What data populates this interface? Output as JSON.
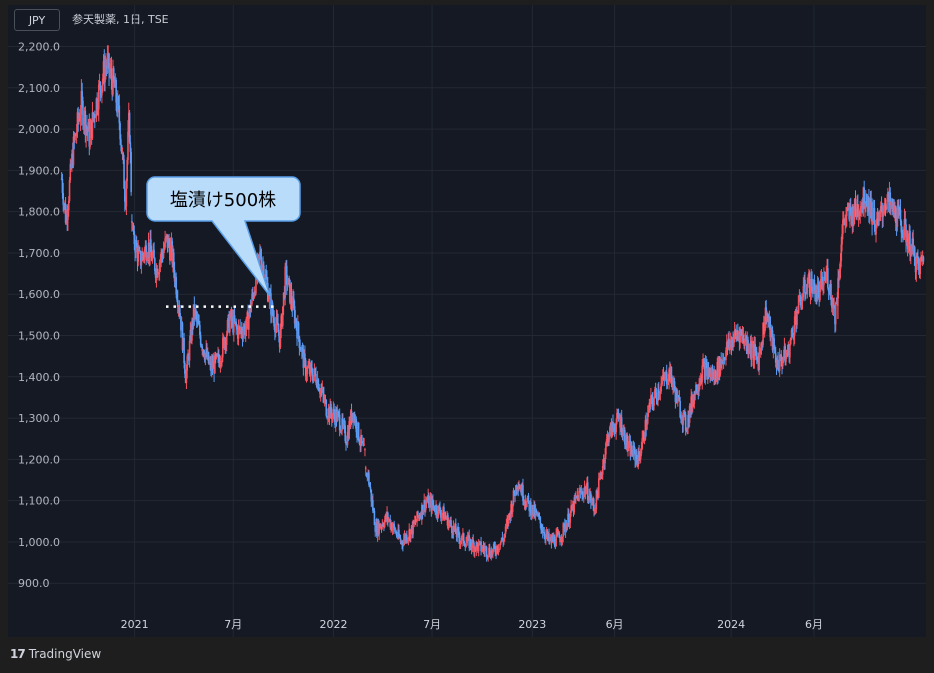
{
  "header": {
    "currency": "JPY",
    "symbol": "参天製薬, 1日, TSE"
  },
  "footer": {
    "brand": "TradingView",
    "logo_icon": "tradingview-logo-icon"
  },
  "annotation": {
    "text": "塩漬け500株",
    "fill": "#b9dcfb",
    "stroke": "#5b9fea",
    "level": 1570
  },
  "colors": {
    "up": "#f7525f",
    "down": "#5b9cf6",
    "background": "#141923",
    "grid": "#232833",
    "axis_text": "#b2b5be"
  },
  "chart_data": {
    "type": "candlestick",
    "title": "参天製薬, 1日, TSE",
    "ylim": [
      840,
      2240
    ],
    "y_ticks": [
      2200,
      2100,
      2000,
      1900,
      1800,
      1700,
      1600,
      1500,
      1400,
      1300,
      1200,
      1100,
      1000,
      900
    ],
    "y_tick_labels": [
      "2,200.0",
      "2,100.0",
      "2,000.0",
      "1,900.0",
      "1,800.0",
      "1,700.0",
      "1,600.0",
      "1,500.0",
      "1,400.0",
      "1,300.0",
      "1,200.0",
      "1,100.0",
      "1,000.0",
      "900.0"
    ],
    "x_range": [
      "2020-08-17",
      "2024-12-20"
    ],
    "x_ticks": [
      {
        "date": "2021-01-01",
        "label": "2021"
      },
      {
        "date": "2021-07-01",
        "label": "7月"
      },
      {
        "date": "2022-01-01",
        "label": "2022"
      },
      {
        "date": "2022-07-01",
        "label": "7月"
      },
      {
        "date": "2023-01-01",
        "label": "2023"
      },
      {
        "date": "2023-06-01",
        "label": "6月"
      },
      {
        "date": "2024-01-01",
        "label": "2024"
      },
      {
        "date": "2024-06-01",
        "label": "6月"
      }
    ],
    "price_path": [
      [
        "2020-08-20",
        1880
      ],
      [
        "2020-08-28",
        1780
      ],
      [
        "2020-09-10",
        1950
      ],
      [
        "2020-09-25",
        2060
      ],
      [
        "2020-10-10",
        1980
      ],
      [
        "2020-10-25",
        2080
      ],
      [
        "2020-11-10",
        2160
      ],
      [
        "2020-11-25",
        2100
      ],
      [
        "2020-12-05",
        2010
      ],
      [
        "2020-12-15",
        1830
      ],
      [
        "2020-12-22",
        2030
      ],
      [
        "2020-12-28",
        1750
      ],
      [
        "2021-01-10",
        1680
      ],
      [
        "2021-01-25",
        1720
      ],
      [
        "2021-02-10",
        1660
      ],
      [
        "2021-03-01",
        1730
      ],
      [
        "2021-03-10",
        1700
      ],
      [
        "2021-03-25",
        1560
      ],
      [
        "2021-04-05",
        1400
      ],
      [
        "2021-04-20",
        1560
      ],
      [
        "2021-05-05",
        1480
      ],
      [
        "2021-05-20",
        1420
      ],
      [
        "2021-06-05",
        1440
      ],
      [
        "2021-06-25",
        1540
      ],
      [
        "2021-07-10",
        1510
      ],
      [
        "2021-07-25",
        1520
      ],
      [
        "2021-08-05",
        1590
      ],
      [
        "2021-08-20",
        1700
      ],
      [
        "2021-09-10",
        1560
      ],
      [
        "2021-09-25",
        1490
      ],
      [
        "2021-10-05",
        1650
      ],
      [
        "2021-10-20",
        1560
      ],
      [
        "2021-11-10",
        1420
      ],
      [
        "2021-12-01",
        1400
      ],
      [
        "2021-12-20",
        1320
      ],
      [
        "2022-01-10",
        1300
      ],
      [
        "2022-01-25",
        1250
      ],
      [
        "2022-02-05",
        1320
      ],
      [
        "2022-02-20",
        1240
      ],
      [
        "2022-02-28",
        1210
      ],
      [
        "2022-03-10",
        1120
      ],
      [
        "2022-03-20",
        1030
      ],
      [
        "2022-04-10",
        1060
      ],
      [
        "2022-05-05",
        1000
      ],
      [
        "2022-05-25",
        1030
      ],
      [
        "2022-06-20",
        1100
      ],
      [
        "2022-07-20",
        1070
      ],
      [
        "2022-08-20",
        1010
      ],
      [
        "2022-09-20",
        990
      ],
      [
        "2022-10-20",
        975
      ],
      [
        "2022-11-10",
        1010
      ],
      [
        "2022-12-05",
        1150
      ],
      [
        "2022-12-20",
        1100
      ],
      [
        "2023-01-10",
        1060
      ],
      [
        "2023-02-01",
        1000
      ],
      [
        "2023-02-20",
        1010
      ],
      [
        "2023-03-10",
        1060
      ],
      [
        "2023-03-25",
        1110
      ],
      [
        "2023-04-10",
        1130
      ],
      [
        "2023-04-25",
        1080
      ],
      [
        "2023-05-05",
        1150
      ],
      [
        "2023-05-20",
        1260
      ],
      [
        "2023-06-10",
        1300
      ],
      [
        "2023-06-25",
        1230
      ],
      [
        "2023-07-15",
        1200
      ],
      [
        "2023-08-05",
        1330
      ],
      [
        "2023-08-25",
        1380
      ],
      [
        "2023-09-10",
        1410
      ],
      [
        "2023-09-25",
        1340
      ],
      [
        "2023-10-10",
        1280
      ],
      [
        "2023-10-25",
        1360
      ],
      [
        "2023-11-10",
        1420
      ],
      [
        "2023-12-01",
        1400
      ],
      [
        "2023-12-25",
        1470
      ],
      [
        "2024-01-15",
        1510
      ],
      [
        "2024-02-01",
        1480
      ],
      [
        "2024-02-20",
        1440
      ],
      [
        "2024-03-05",
        1560
      ],
      [
        "2024-03-25",
        1430
      ],
      [
        "2024-04-15",
        1460
      ],
      [
        "2024-05-01",
        1560
      ],
      [
        "2024-05-20",
        1630
      ],
      [
        "2024-06-10",
        1600
      ],
      [
        "2024-06-25",
        1650
      ],
      [
        "2024-07-10",
        1550
      ],
      [
        "2024-07-25",
        1780
      ],
      [
        "2024-08-15",
        1800
      ],
      [
        "2024-09-05",
        1840
      ],
      [
        "2024-09-25",
        1760
      ],
      [
        "2024-10-10",
        1830
      ],
      [
        "2024-11-05",
        1780
      ],
      [
        "2024-11-25",
        1720
      ],
      [
        "2024-12-10",
        1660
      ],
      [
        "2024-12-20",
        1690
      ]
    ],
    "spikes": [
      {
        "date": "2024-07-15",
        "low": 1540
      }
    ],
    "gaps": [
      "2020-12-28",
      "2022-03-01"
    ]
  }
}
